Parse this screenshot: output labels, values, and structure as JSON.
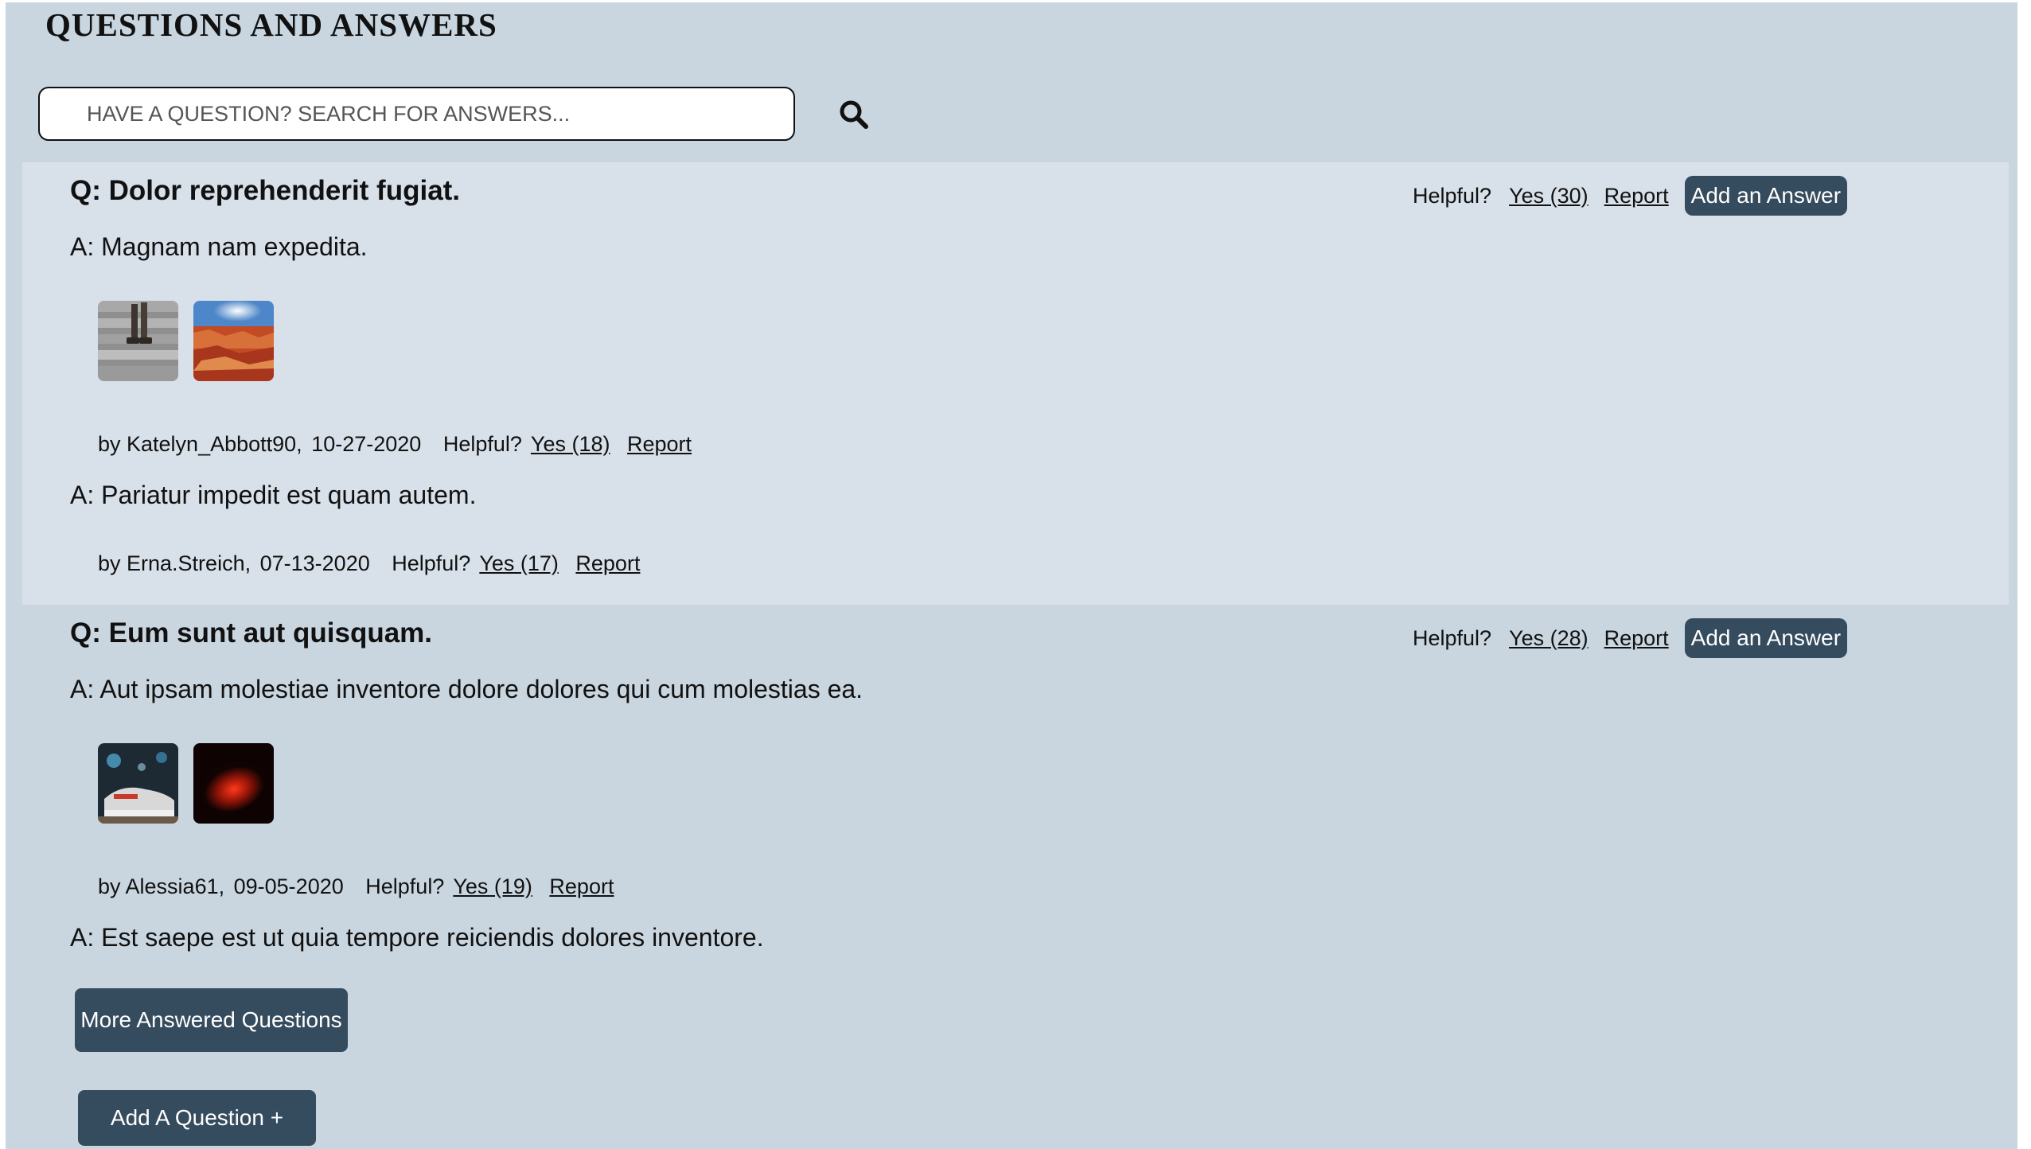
{
  "header": {
    "title": "QUESTIONS AND ANSWERS"
  },
  "search": {
    "placeholder": "HAVE A QUESTION? SEARCH FOR ANSWERS...",
    "icon": "search-icon"
  },
  "questions": [
    {
      "question": "Q: Dolor reprehenderit fugiat.",
      "helpful_label": "Helpful?",
      "helpful_yes": "Yes (30)",
      "report_label": "Report",
      "add_answer_label": "Add an Answer",
      "answers": [
        {
          "text": "A: Magnam nam expedita.",
          "photos": [
            "stairs-boots-photo",
            "canyon-sunset-photo"
          ],
          "by": "by Katelyn_Abbott90,",
          "date": "10-27-2020",
          "helpful_label": "Helpful?",
          "helpful_yes": "Yes (18)",
          "report_label": "Report"
        },
        {
          "text": "A: Pariatur impedit est quam autem.",
          "photos": [],
          "by": "by Erna.Streich,",
          "date": "07-13-2020",
          "helpful_label": "Helpful?",
          "helpful_yes": "Yes (17)",
          "report_label": "Report"
        }
      ]
    },
    {
      "question": "Q: Eum sunt aut quisquam.",
      "helpful_label": "Helpful?",
      "helpful_yes": "Yes (28)",
      "report_label": "Report",
      "add_answer_label": "Add an Answer",
      "answers": [
        {
          "text": "A: Aut ipsam molestiae inventore dolore dolores qui cum molestias ea.",
          "photos": [
            "sneaker-night-photo",
            "red-glow-photo"
          ],
          "by": "by Alessia61,",
          "date": "09-05-2020",
          "helpful_label": "Helpful?",
          "helpful_yes": "Yes (19)",
          "report_label": "Report"
        },
        {
          "text": "A: Est saepe est ut quia tempore reiciendis dolores inventore."
        }
      ]
    }
  ],
  "buttons": {
    "more_answered": "More Answered Questions",
    "add_question": "Add A Question +"
  },
  "colors": {
    "page_background": "#c9d6e0",
    "highlight_background": "#d8e0e9",
    "button_background": "#354b5e",
    "button_text": "#ffffff"
  }
}
